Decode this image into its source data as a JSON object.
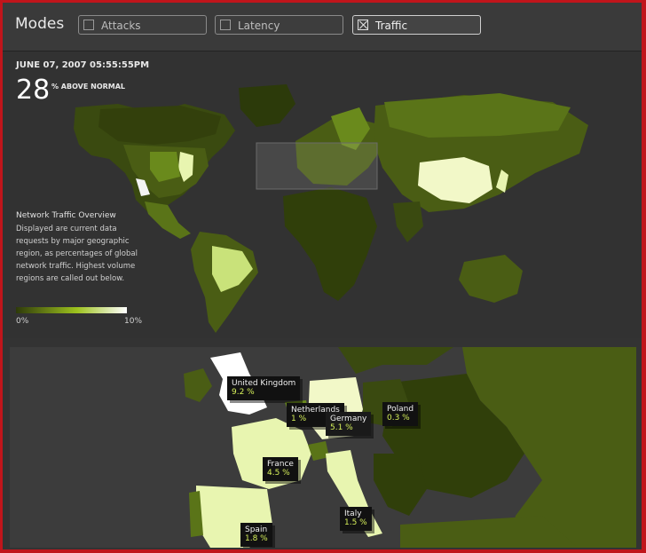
{
  "header": {
    "title": "Modes"
  },
  "modes": [
    {
      "label": "Attacks",
      "checked": false
    },
    {
      "label": "Latency",
      "checked": false
    },
    {
      "label": "Traffic",
      "checked": true
    }
  ],
  "stats": {
    "timestamp": "JUNE 07, 2007 05:55:55PM",
    "value": "28",
    "caption": "% ABOVE NORMAL"
  },
  "overview": {
    "title": "Network Traffic Overview",
    "text": "Displayed are current data requests by major geographic region, as percentages of global network traffic. Highest volume regions are called out below."
  },
  "legend": {
    "min": "0%",
    "max": "10%"
  },
  "callouts": [
    {
      "name": "United Kingdom",
      "value": "9.2 %"
    },
    {
      "name": "Netherlands",
      "value": "1 %"
    },
    {
      "name": "Germany",
      "value": "5.1 %"
    },
    {
      "name": "Poland",
      "value": "0.3 %"
    },
    {
      "name": "France",
      "value": "4.5 %"
    },
    {
      "name": "Italy",
      "value": "1.5 %"
    },
    {
      "name": "Spain",
      "value": "1.8 %"
    }
  ],
  "colors": {
    "frame": "#c0151b",
    "background": "#333333",
    "land_low": "#2f3d0c",
    "land_high": "#ffffff",
    "accent": "#d6f05a"
  }
}
